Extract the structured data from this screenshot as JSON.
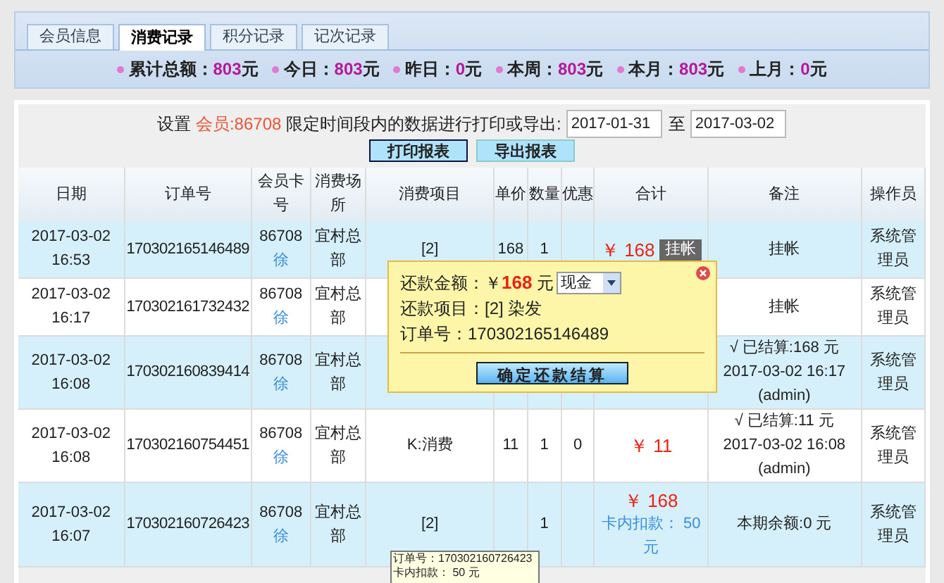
{
  "tabs": [
    {
      "label": "会员信息",
      "selected": false
    },
    {
      "label": "消费记录",
      "selected": true
    },
    {
      "label": "积分记录",
      "selected": false
    },
    {
      "label": "记次记录",
      "selected": false
    }
  ],
  "stats": [
    {
      "label": "累计总额：",
      "value": "803",
      "unit": "元"
    },
    {
      "label": "今日：",
      "value": "803",
      "unit": "元"
    },
    {
      "label": "昨日：",
      "value": "0",
      "unit": "元"
    },
    {
      "label": "本周：",
      "value": "803",
      "unit": "元"
    },
    {
      "label": "本月：",
      "value": "803",
      "unit": "元"
    },
    {
      "label": "上月：",
      "value": "0",
      "unit": "元"
    }
  ],
  "export": {
    "prefix": "设置",
    "member": "会员:86708",
    "suffix": "限定时间段内的数据进行打印或导出:",
    "from": "2017-01-31",
    "to_label": "至",
    "to": "2017-03-02",
    "buttons": [
      "打印报表",
      "导出报表"
    ]
  },
  "table": {
    "columns": [
      "日期",
      "订单号",
      "会员卡号",
      "消费场所",
      "消费项目",
      "单价",
      "数量",
      "优惠",
      "合计",
      "备注",
      "操作员"
    ],
    "rows": [
      {
        "highlighted": true,
        "date": [
          "2017-03-02",
          "16:53"
        ],
        "order": "170302165146489",
        "card": "86708",
        "name": "徐",
        "place": "宜村总部",
        "item": "[2]",
        "price": "168",
        "qty": "1",
        "discount": "",
        "total": "￥ 168",
        "button": "挂帐",
        "details": [],
        "note": [
          "挂帐"
        ],
        "operator": "系统管理员"
      },
      {
        "highlighted": false,
        "date": [
          "2017-03-02",
          "16:17"
        ],
        "order": "170302161732432",
        "card": "86708",
        "name": "徐",
        "place": "宜村总部",
        "item": "",
        "price": "",
        "qty": "",
        "discount": "",
        "total": "",
        "button": "",
        "details": [],
        "note": [
          "挂帐"
        ],
        "operator": "系统管理员"
      },
      {
        "highlighted": true,
        "date": [
          "2017-03-02",
          "16:08"
        ],
        "order": "170302160839414",
        "card": "86708",
        "name": "徐",
        "place": "宜村总部",
        "item": "",
        "price": "",
        "qty": "",
        "discount": "",
        "total": "",
        "button": "",
        "details": [],
        "note": [
          "√ 已结算:168 元",
          "2017-03-02 16:17",
          "(admin)"
        ],
        "operator": "系统管理员"
      },
      {
        "highlighted": false,
        "date": [
          "2017-03-02",
          "16:08"
        ],
        "order": "170302160754451",
        "card": "86708",
        "name": "徐",
        "place": "宜村总部",
        "item": "K:消费",
        "price": "11",
        "qty": "1",
        "discount": "0",
        "total": "￥ 11",
        "button": "",
        "details": [],
        "note": [
          "√ 已结算:11 元",
          "2017-03-02 16:08",
          "(admin)"
        ],
        "operator": "系统管理员"
      },
      {
        "highlighted": true,
        "date": [
          "2017-03-02",
          "16:07"
        ],
        "order": "170302160726423",
        "card": "86708",
        "name": "徐",
        "place": "宜村总部",
        "item": "[2]",
        "price": "",
        "qty": "1",
        "discount": "",
        "total": "￥ 168",
        "button": "",
        "details": [
          "卡内扣款： 50 元"
        ],
        "note": [
          "本期余额:0 元"
        ],
        "operator": "系统管理员"
      }
    ]
  },
  "popup": {
    "amount_label": "还款金额：￥",
    "amount": "168",
    "unit": "元",
    "method": "现金",
    "item": "还款项目：[2] 染发",
    "order": "订单号：170302165146489",
    "confirm": "确定还款结算"
  },
  "tooltip": [
    "订单号：170302160726423",
    "卡内扣款： 50 元"
  ]
}
